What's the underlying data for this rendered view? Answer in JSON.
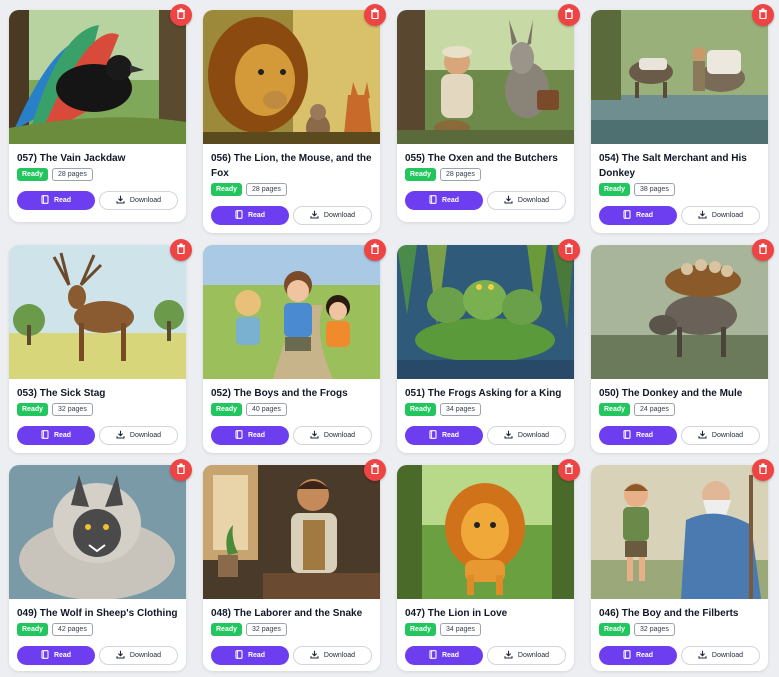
{
  "labels": {
    "ready": "Ready",
    "read": "Read",
    "download": "Download"
  },
  "colors": {
    "accent_purple": "#6d3df0",
    "ready_green": "#22c55e",
    "delete_red": "#ef4444"
  },
  "icons": {
    "delete": "trash-icon",
    "read": "book-icon",
    "download": "download-icon"
  },
  "books": [
    {
      "title": "057) The Vain Jackdaw",
      "pages": "28 pages"
    },
    {
      "title": "056) The Lion, the Mouse, and the Fox",
      "pages": "28 pages"
    },
    {
      "title": "055) The Oxen and the Butchers",
      "pages": "28 pages"
    },
    {
      "title": "054) The Salt Merchant and His Donkey",
      "pages": "38 pages"
    },
    {
      "title": "053) The Sick Stag",
      "pages": "32 pages"
    },
    {
      "title": "052) The Boys and the Frogs",
      "pages": "40 pages"
    },
    {
      "title": "051) The Frogs Asking for a King",
      "pages": "34 pages"
    },
    {
      "title": "050) The Donkey and the Mule",
      "pages": "24 pages"
    },
    {
      "title": "049) The Wolf in Sheep's Clothing",
      "pages": "42 pages"
    },
    {
      "title": "048) The Laborer and the Snake",
      "pages": "32 pages"
    },
    {
      "title": "047) The Lion in Love",
      "pages": "34 pages"
    },
    {
      "title": "046) The Boy and the Filberts",
      "pages": "32 pages"
    }
  ]
}
